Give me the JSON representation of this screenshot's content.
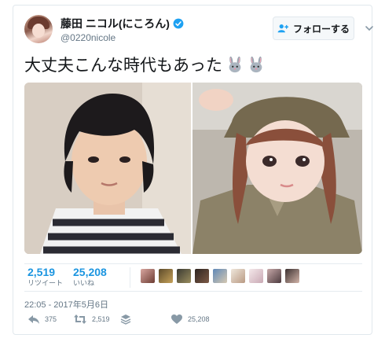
{
  "author": {
    "display_name": "藤田 ニコル(にころん)",
    "handle": "@0220nicole",
    "verified": true
  },
  "follow_button": {
    "label": "フォローする"
  },
  "tweet": {
    "text": "大丈夫こんな時代もあった",
    "emoji": [
      "rabbit-face-icon",
      "rabbit-face-icon"
    ]
  },
  "stats": {
    "retweets": {
      "value": "2,519",
      "label": "リツイート"
    },
    "likes": {
      "value": "25,208",
      "label": "いいね"
    }
  },
  "timestamp": "22:05 - 2017年5月6日",
  "actions": {
    "reply_count": "375",
    "retweet_count": "2,519",
    "like_count": "25,208"
  },
  "colors": {
    "link_blue": "#1b95e0",
    "verified_blue": "#1da1f2",
    "text_primary": "#14171a",
    "text_secondary": "#657786",
    "border": "#e1e8ed"
  }
}
